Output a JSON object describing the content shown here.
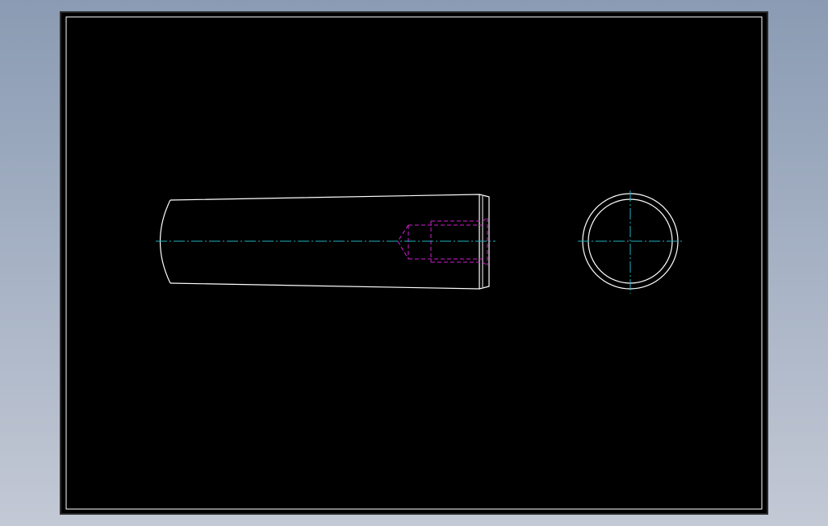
{
  "colors": {
    "background_gradient_top": "#8a9bb3",
    "background_gradient_bottom": "#c3c9d5",
    "sheet": "#000000",
    "frame_outer": "#2a2a2a",
    "frame_inner": "#ffffff",
    "outline": "#ffffff",
    "hidden_lines": "#d020d0",
    "centerlines": "#20b0c0"
  },
  "views": [
    {
      "kind": "front-view",
      "shape": "tapered-pin-with-threaded-hole"
    },
    {
      "kind": "end-view",
      "shape": "concentric-circles"
    }
  ]
}
